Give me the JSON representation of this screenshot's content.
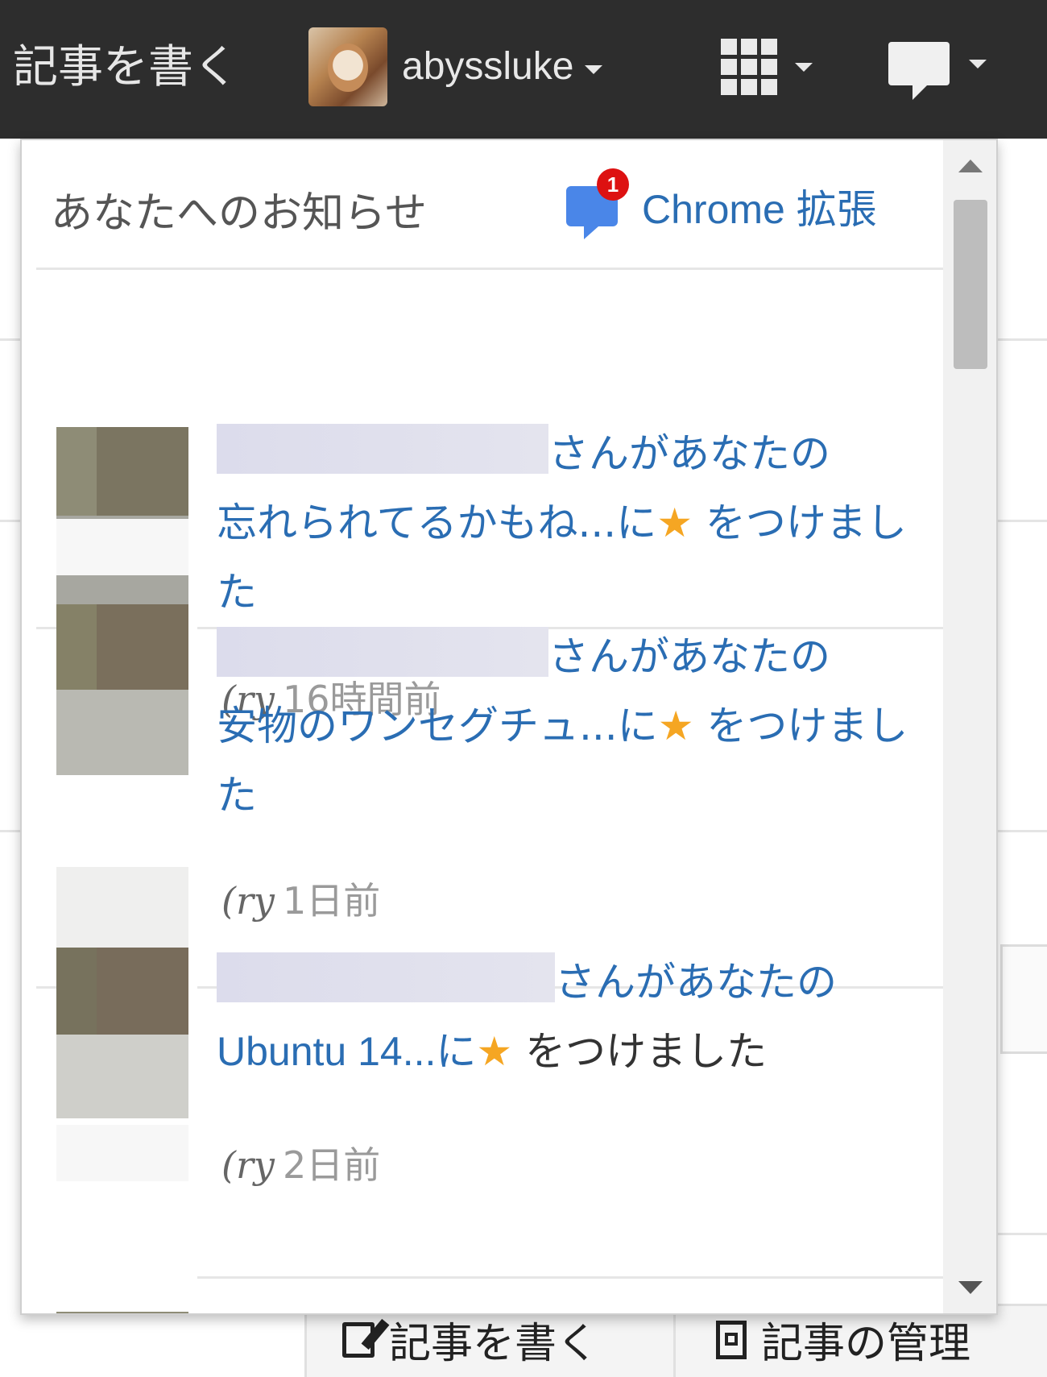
{
  "topbar": {
    "write_label": "記事を書く",
    "username": "abyssluke"
  },
  "notifications": {
    "title": "あなたへのお知らせ",
    "chrome_badge": "1",
    "chrome_link": "Chrome 拡張",
    "items": [
      {
        "prefix": "さんがあなたの",
        "article": "忘れられてるかもね...",
        "suffix_a": "に",
        "star": "★",
        "suffix_b": " をつけました",
        "source": "(ry",
        "time": "16時間前"
      },
      {
        "prefix": "さんがあなたの",
        "article": "安物のワンセグチュ...",
        "suffix_a": "に",
        "star": "★",
        "suffix_b": " をつけました",
        "source": "(ry",
        "time": "1日前"
      },
      {
        "prefix": "さんがあなたの",
        "article": "Ubuntu 14...",
        "suffix_a": "に",
        "star": "★",
        "suffix_b": " をつけました",
        "source": "(ry",
        "time": "2日前"
      }
    ]
  },
  "page": {
    "tab_write": "記事を書く",
    "tab_manage": "記事の管理"
  },
  "colors": {
    "topbar": "#2d2d2d",
    "link": "#2a6db3",
    "star": "#f5a623",
    "badge": "#dd1111"
  }
}
